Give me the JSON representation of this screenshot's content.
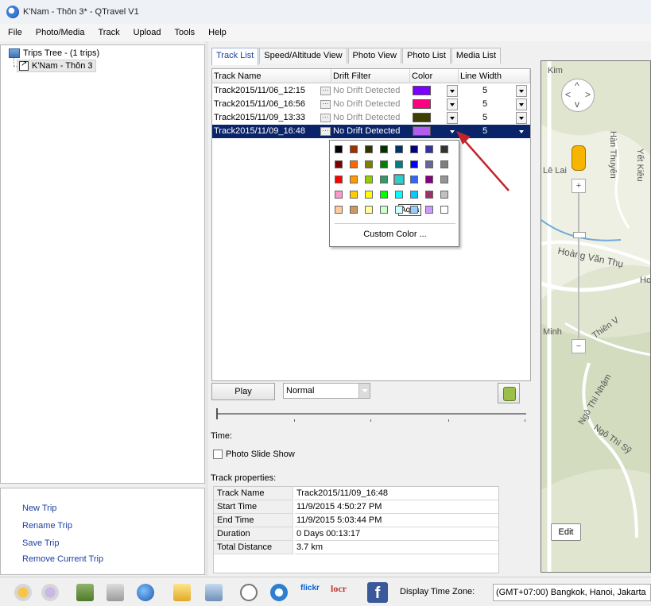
{
  "window": {
    "title": "K'Nam - Thôn 3* - QTravel V1"
  },
  "menu": [
    "File",
    "Photo/Media",
    "Track",
    "Upload",
    "Tools",
    "Help"
  ],
  "tree": {
    "root_label": "Trips Tree  -  (1 trips)",
    "child_label": "K'Nam - Thôn 3"
  },
  "left_links": [
    "New Trip",
    "Rename Trip",
    "Save Trip",
    "Remove Current Trip"
  ],
  "tabs": [
    "Track List",
    "Speed/Altitude View",
    "Photo View",
    "Photo List",
    "Media List"
  ],
  "grid": {
    "headers": [
      "Track Name",
      "Drift Filter",
      "Color",
      "Line Width"
    ],
    "rows": [
      {
        "name": "Track2015/11/06_12:15",
        "drift": "No Drift Detected",
        "color": "#7a00ff",
        "width": "5"
      },
      {
        "name": "Track2015/11/06_16:56",
        "drift": "No Drift Detected",
        "color": "#ff0080",
        "width": "5"
      },
      {
        "name": "Track2015/11/09_13:33",
        "drift": "No Drift Detected",
        "color": "#3f3f00",
        "width": "5"
      },
      {
        "name": "Track2015/11/09_16:48",
        "drift": "No Drift Detected",
        "color": "#b45cf0",
        "width": "5"
      }
    ]
  },
  "palette": {
    "tooltip": "Aqua",
    "custom_label": "Custom Color ...",
    "highlighted": "Aqua",
    "colors": [
      [
        "#000000",
        "#993300",
        "#333300",
        "#003300",
        "#003366",
        "#000080",
        "#333399",
        "#333333"
      ],
      [
        "#800000",
        "#ff6600",
        "#808000",
        "#008000",
        "#008080",
        "#0000ff",
        "#666699",
        "#808080"
      ],
      [
        "#ff0000",
        "#ff9900",
        "#99cc00",
        "#339966",
        "#33cccc",
        "#3366ff",
        "#800080",
        "#969696"
      ],
      [
        "#ff99cc",
        "#ffcc00",
        "#ffff00",
        "#00ff00",
        "#00ffff",
        "#00ccff",
        "#993366",
        "#c0c0c0"
      ],
      [
        "#ffcc99",
        "#cc9966",
        "#ffff99",
        "#ccffcc",
        "#ccffff",
        "#99ccff",
        "#cc99ff",
        "#ffffff"
      ]
    ]
  },
  "playback": {
    "play_label": "Play",
    "speed_value": "Normal",
    "time_label": "Time:",
    "slideshow_label": "Photo Slide Show"
  },
  "properties": {
    "title": "Track properties:",
    "rows": [
      {
        "key": "Track Name",
        "value": "Track2015/11/09_16:48"
      },
      {
        "key": "Start Time",
        "value": "11/9/2015 4:50:27 PM"
      },
      {
        "key": "End Time",
        "value": "11/9/2015 5:03:44 PM"
      },
      {
        "key": "Duration",
        "value": "0 Days  00:13:17"
      },
      {
        "key": "Total Distance",
        "value": "3.7 km"
      }
    ]
  },
  "map": {
    "labels": [
      "Kim",
      "Hàn Thuyên",
      "Lê Lai",
      "Hoàng Văn Thụ",
      "Minh",
      "Thiên V",
      "Ngô Thì Nhậm",
      "Ngô Thì Sỹ",
      "Hc",
      "Yết Kiêu"
    ],
    "edit_label": "Edit"
  },
  "taskbar": {
    "icons": [
      "orange-circle-icon",
      "grey-circle-icon",
      "scanner-icon",
      "satellite-icon",
      "globe-icon",
      "folder-icon",
      "photos-icon",
      "clock-icon",
      "window-icon",
      "flickr-icon",
      "locr-icon",
      "facebook-icon"
    ],
    "flickr_text": "flickr",
    "locr_text": "locr",
    "facebook_text": "f",
    "timezone_label": "Display Time Zone:",
    "timezone_value": "(GMT+07:00) Bangkok, Hanoi, Jakarta"
  },
  "colors": {
    "selection": "#0a246a",
    "link": "#1a3fa0",
    "arrow": "#c0252b"
  }
}
